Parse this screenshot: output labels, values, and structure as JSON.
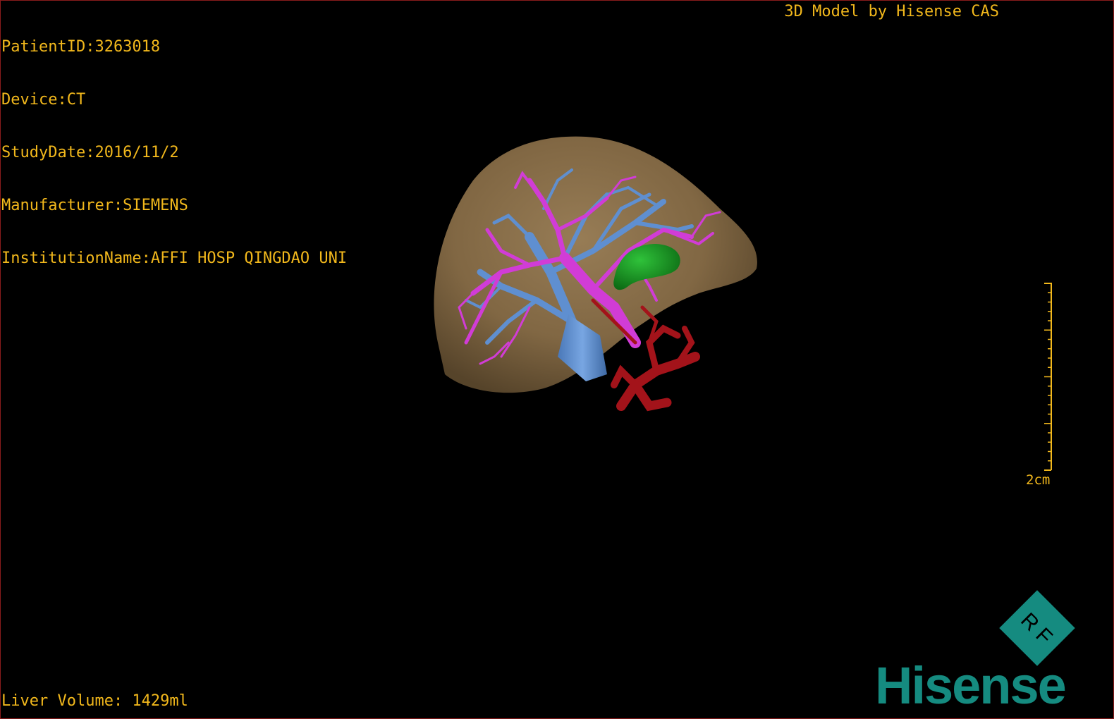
{
  "header": {
    "patient_id": "PatientID:3263018",
    "device": "Device:CT",
    "study_date": "StudyDate:2016/11/2",
    "manufacturer": "Manufacturer:SIEMENS",
    "institution": "InstitutionName:AFFI HOSP QINGDAO UNI"
  },
  "credit": "3D Model by Hisense CAS",
  "footer": {
    "liver_volume": "Liver Volume: 1429ml"
  },
  "scale": {
    "label": "2cm"
  },
  "logo": {
    "badge_text": "R F",
    "brand": "Hisense"
  },
  "colors": {
    "overlay_text": "#f2b81c",
    "liver": "#8c7049",
    "portal_vein": "#d13cd6",
    "hepatic_vein": "#5f8fd0",
    "artery": "#a3131a",
    "gallbladder": "#16921f",
    "brand": "#158b80"
  },
  "icons": {
    "model": "liver-3d-model-icon",
    "scale": "ruler-icon",
    "logo_badge": "diamond-logo-icon"
  }
}
